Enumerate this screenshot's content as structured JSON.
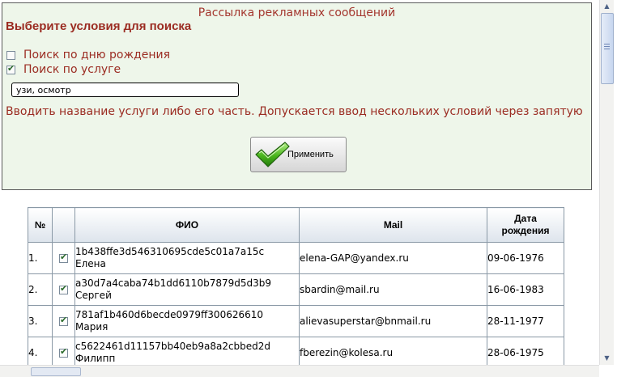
{
  "panel": {
    "title": "Рассылка рекламных сообщений",
    "heading": "Выберите условия для поиска",
    "options": [
      {
        "label": "Поиск по дню рождения",
        "checked": false
      },
      {
        "label": "Поиск по услуге",
        "checked": true
      }
    ],
    "service_input_value": "узи, осмотр",
    "hint": "Вводить название услуги либо его часть. Допускается ввод нескольких условий через запятую",
    "apply_label": "Применить"
  },
  "table": {
    "headers": {
      "num": "№",
      "fio": "ФИО",
      "mail": "Mail",
      "date_line1": "Дата",
      "date_line2": "рождения"
    },
    "rows": [
      {
        "num": "1.",
        "checked": true,
        "id": "1b438ffe3d546310695cde5c01a7a15c",
        "name": "Елена",
        "mail": "elena-GAP@yandex.ru",
        "date": "09-06-1976"
      },
      {
        "num": "2.",
        "checked": true,
        "id": "a30d7a4caba74b1dd6110b7879d5d3b9",
        "name": "Сергей",
        "mail": "sbardin@mail.ru",
        "date": "16-06-1983"
      },
      {
        "num": "3.",
        "checked": true,
        "id": "781af1b460d6becde0979ff300626610",
        "name": "Мария",
        "mail": "alievasuperstar@bnmail.ru",
        "date": "28-11-1977"
      },
      {
        "num": "4.",
        "checked": true,
        "id": "c5622461d11157bb40eb9a8a2cbbed2d",
        "name": "Филипп",
        "mail": "fberezin@kolesa.ru",
        "date": "28-06-1975"
      }
    ]
  },
  "colors": {
    "text_accent": "#9b2c22",
    "panel_bg": "#eef6ea"
  },
  "icons": {
    "apply": "checkmark-icon",
    "scroll_up": "arrow-up-icon",
    "scroll_down": "arrow-down-icon"
  }
}
